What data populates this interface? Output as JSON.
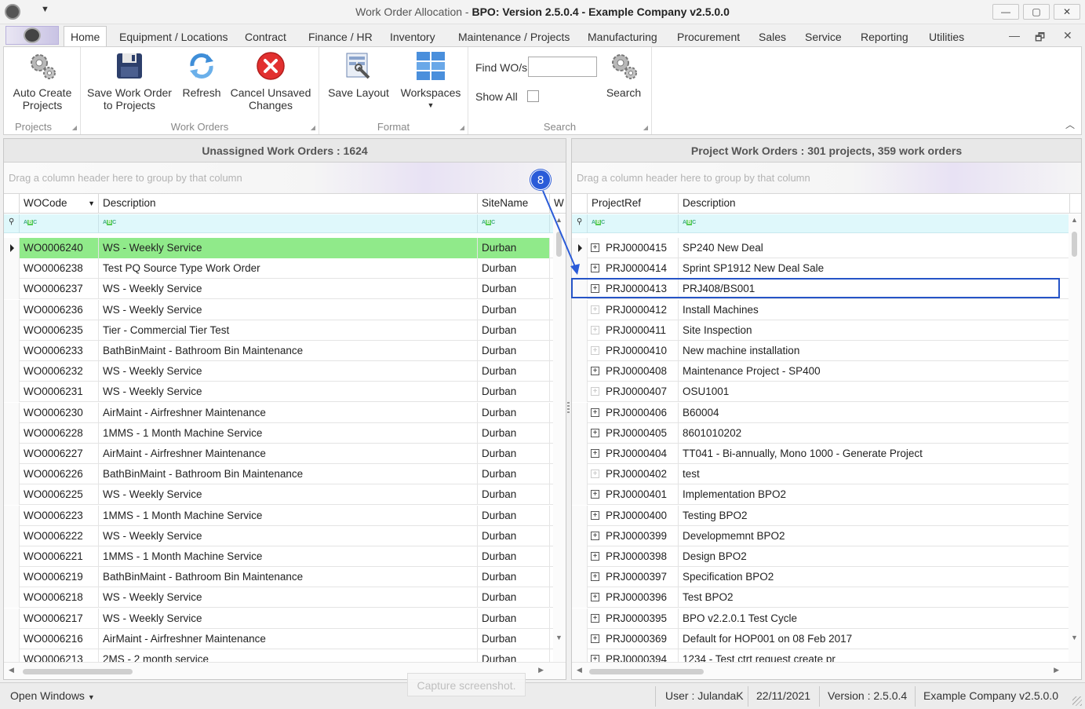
{
  "window": {
    "title_prefix": "Work Order Allocation - ",
    "title_bold": "BPO: Version 2.5.0.4 - Example Company v2.5.0.0",
    "minimize": "—",
    "maximize": "▢",
    "close": "✕"
  },
  "menu": {
    "tabs": [
      "Home",
      "Equipment / Locations",
      "Contract",
      "Finance / HR",
      "Inventory",
      "Maintenance / Projects",
      "Manufacturing",
      "Procurement",
      "Sales",
      "Service",
      "Reporting",
      "Utilities"
    ],
    "mdi_min": "—",
    "mdi_restore": "🗗",
    "mdi_close": "✕"
  },
  "ribbon": {
    "groups": {
      "projects": "Projects",
      "work_orders": "Work Orders",
      "format": "Format",
      "search": "Search"
    },
    "auto_create_line1": "Auto Create",
    "auto_create_line2": "Projects",
    "save_wo_line1": "Save Work Order",
    "save_wo_line2": "to Projects",
    "refresh": "Refresh",
    "cancel_line1": "Cancel Unsaved",
    "cancel_line2": "Changes",
    "save_layout": "Save Layout",
    "workspaces": "Workspaces",
    "find_label": "Find WO/s",
    "find_value": "",
    "show_all": "Show All",
    "search": "Search"
  },
  "left_panel": {
    "title": "Unassigned Work Orders : 1624",
    "group_hint": "Drag a column header here to group by that column",
    "columns": [
      "WOCode",
      "Description",
      "SiteName",
      "W"
    ],
    "rows": [
      [
        "WO0006240",
        "WS - Weekly Service",
        "Durban"
      ],
      [
        "WO0006238",
        "Test PQ Source Type Work Order",
        "Durban"
      ],
      [
        "WO0006237",
        "WS - Weekly Service",
        "Durban"
      ],
      [
        "WO0006236",
        "WS - Weekly Service",
        "Durban"
      ],
      [
        "WO0006235",
        "Tier - Commercial Tier Test",
        "Durban"
      ],
      [
        "WO0006233",
        "BathBinMaint - Bathroom Bin Maintenance",
        "Durban"
      ],
      [
        "WO0006232",
        "WS - Weekly Service",
        "Durban"
      ],
      [
        "WO0006231",
        "WS - Weekly Service",
        "Durban"
      ],
      [
        "WO0006230",
        "AirMaint - Airfreshner Maintenance",
        "Durban"
      ],
      [
        "WO0006228",
        "1MMS - 1 Month Machine Service",
        "Durban"
      ],
      [
        "WO0006227",
        "AirMaint - Airfreshner Maintenance",
        "Durban"
      ],
      [
        "WO0006226",
        "BathBinMaint - Bathroom Bin Maintenance",
        "Durban"
      ],
      [
        "WO0006225",
        "WS - Weekly Service",
        "Durban"
      ],
      [
        "WO0006223",
        "1MMS - 1 Month Machine Service",
        "Durban"
      ],
      [
        "WO0006222",
        "WS - Weekly Service",
        "Durban"
      ],
      [
        "WO0006221",
        "1MMS - 1 Month Machine Service",
        "Durban"
      ],
      [
        "WO0006219",
        "BathBinMaint - Bathroom Bin Maintenance",
        "Durban"
      ],
      [
        "WO0006218",
        "WS - Weekly Service",
        "Durban"
      ],
      [
        "WO0006217",
        "WS - Weekly Service",
        "Durban"
      ],
      [
        "WO0006216",
        "AirMaint - Airfreshner Maintenance",
        "Durban"
      ],
      [
        "WO0006213",
        "2MS - 2 month service",
        "Durban"
      ]
    ]
  },
  "right_panel": {
    "title": "Project Work Orders : 301 projects, 359 work orders",
    "group_hint": "Drag a column header here to group by that column",
    "columns": [
      "ProjectRef",
      "Description"
    ],
    "rows": [
      [
        "PRJ0000415",
        "SP240 New Deal"
      ],
      [
        "PRJ0000414",
        "Sprint SP1912 New Deal Sale"
      ],
      [
        "PRJ0000413",
        "PRJ408/BS001"
      ],
      [
        "PRJ0000412",
        "Install Machines"
      ],
      [
        "PRJ0000411",
        "Site Inspection"
      ],
      [
        "PRJ0000410",
        "New machine installation"
      ],
      [
        "PRJ0000408",
        "Maintenance Project - SP400"
      ],
      [
        "PRJ0000407",
        "OSU1001"
      ],
      [
        "PRJ0000406",
        "B60004"
      ],
      [
        "PRJ0000405",
        "8601010202"
      ],
      [
        "PRJ0000404",
        "TT041 - Bi-annually, Mono 1000 - Generate Project"
      ],
      [
        "PRJ0000402",
        "test"
      ],
      [
        "PRJ0000401",
        "Implementation BPO2"
      ],
      [
        "PRJ0000400",
        "Testing BPO2"
      ],
      [
        "PRJ0000399",
        "Developmemnt BPO2"
      ],
      [
        "PRJ0000398",
        "Design BPO2"
      ],
      [
        "PRJ0000397",
        "Specification BPO2"
      ],
      [
        "PRJ0000396",
        "Test BPO2"
      ],
      [
        "PRJ0000395",
        "BPO v2.2.0.1 Test Cycle"
      ],
      [
        "PRJ0000369",
        "Default for HOP001 on 08 Feb 2017"
      ],
      [
        "PRJ0000394",
        "1234 - Test ctrt request create pr"
      ]
    ]
  },
  "callout": {
    "number": "8"
  },
  "capture": "Capture screenshot.",
  "status": {
    "open_windows": "Open Windows",
    "user": "User : JulandaK",
    "date": "22/11/2021",
    "version": "Version : 2.5.0.4",
    "company": "Example Company v2.5.0.0"
  },
  "colors": {
    "selected_row": "#90ea8a",
    "highlight": "#2554c7",
    "callout": "#2a5bd8"
  }
}
